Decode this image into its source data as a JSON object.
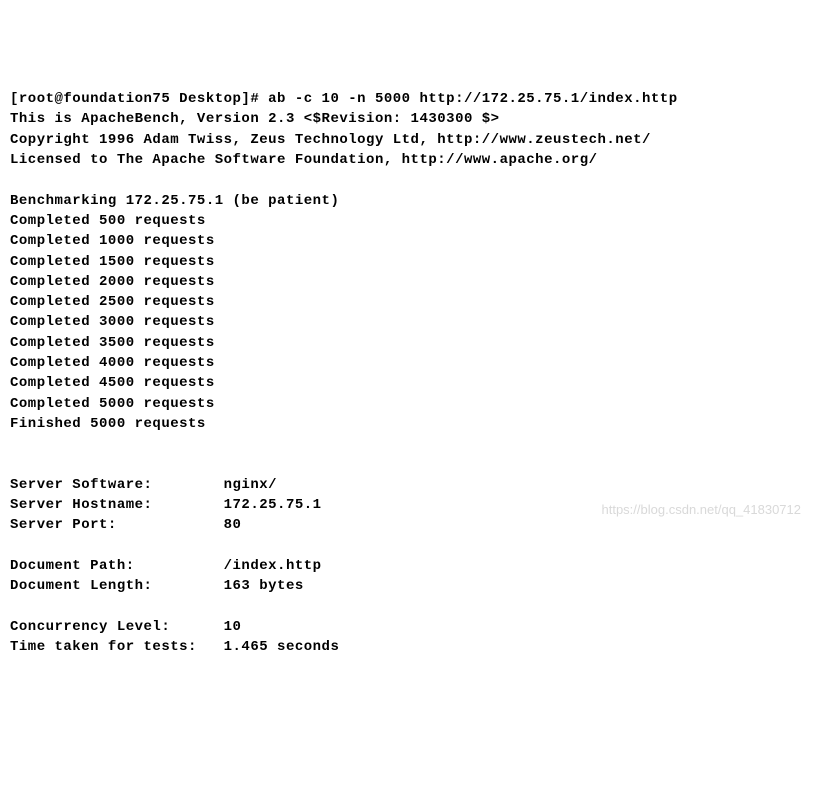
{
  "terminal": {
    "prompt_line": "[root@foundation75 Desktop]# ab -c 10 -n 5000 http://172.25.75.1/index.http",
    "header_version": "This is ApacheBench, Version 2.3 <$Revision: 1430300 $>",
    "header_copyright": "Copyright 1996 Adam Twiss, Zeus Technology Ltd, http://www.zeustech.net/",
    "header_license": "Licensed to The Apache Software Foundation, http://www.apache.org/",
    "blank1": "",
    "benchmarking": "Benchmarking 172.25.75.1 (be patient)",
    "completed": [
      "Completed 500 requests",
      "Completed 1000 requests",
      "Completed 1500 requests",
      "Completed 2000 requests",
      "Completed 2500 requests",
      "Completed 3000 requests",
      "Completed 3500 requests",
      "Completed 4000 requests",
      "Completed 4500 requests",
      "Completed 5000 requests"
    ],
    "finished": "Finished 5000 requests",
    "blank2": "",
    "blank3": "",
    "server_software": "Server Software:        nginx/",
    "server_hostname": "Server Hostname:        172.25.75.1",
    "server_port": "Server Port:            80",
    "blank4": "",
    "document_path": "Document Path:          /index.http",
    "document_length": "Document Length:        163 bytes",
    "blank5": "",
    "concurrency": "Concurrency Level:      10",
    "time_taken": "Time taken for tests:   1.465 seconds"
  },
  "watermark": "https://blog.csdn.net/qq_41830712"
}
